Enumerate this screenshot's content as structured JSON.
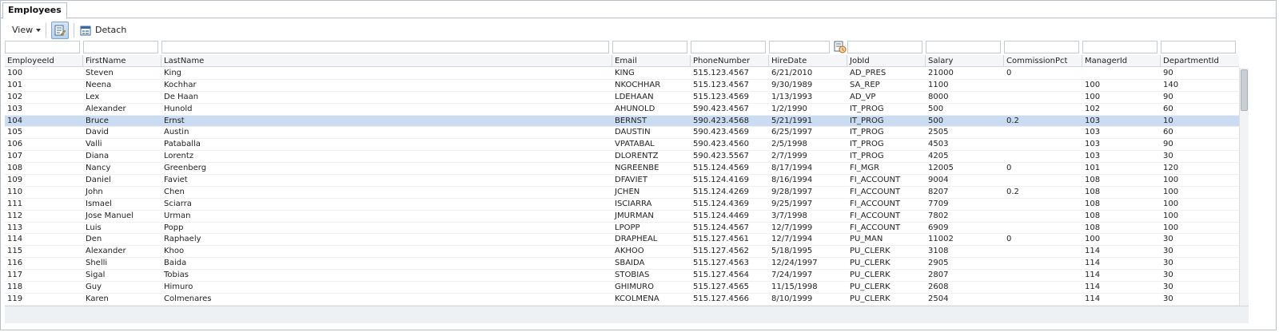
{
  "tab": {
    "label": "Employees"
  },
  "toolbar": {
    "view_label": "View",
    "detach_label": "Detach"
  },
  "columns": [
    {
      "key": "id",
      "label": "EmployeeId"
    },
    {
      "key": "first",
      "label": "FirstName"
    },
    {
      "key": "last",
      "label": "LastName"
    },
    {
      "key": "email",
      "label": "Email"
    },
    {
      "key": "phone",
      "label": "PhoneNumber"
    },
    {
      "key": "hire",
      "label": "HireDate"
    },
    {
      "key": "job",
      "label": "JobId"
    },
    {
      "key": "salary",
      "label": "Salary"
    },
    {
      "key": "comm",
      "label": "CommissionPct"
    },
    {
      "key": "mgr",
      "label": "ManagerId"
    },
    {
      "key": "dept",
      "label": "DepartmentId"
    }
  ],
  "rows": [
    {
      "id": "100",
      "first": "Steven",
      "last": "King",
      "email": "KING",
      "phone": "515.123.4567",
      "hire": "6/21/2010",
      "job": "AD_PRES",
      "salary": "21000",
      "comm": "0",
      "mgr": "",
      "dept": "90"
    },
    {
      "id": "101",
      "first": "Neena",
      "last": "Kochhar",
      "email": "NKOCHHAR",
      "phone": "515.123.4567",
      "hire": "9/30/1989",
      "job": "SA_REP",
      "salary": "1100",
      "comm": "",
      "mgr": "100",
      "dept": "140"
    },
    {
      "id": "102",
      "first": "Lex",
      "last": "De Haan",
      "email": "LDEHAAN",
      "phone": "515.123.4569",
      "hire": "1/13/1993",
      "job": "AD_VP",
      "salary": "8000",
      "comm": "",
      "mgr": "100",
      "dept": "90"
    },
    {
      "id": "103",
      "first": "Alexander",
      "last": "Hunold",
      "email": "AHUNOLD",
      "phone": "590.423.4567",
      "hire": "1/2/1990",
      "job": "IT_PROG",
      "salary": "500",
      "comm": "",
      "mgr": "102",
      "dept": "60"
    },
    {
      "id": "104",
      "first": "Bruce",
      "last": "Ernst",
      "email": "BERNST",
      "phone": "590.423.4568",
      "hire": "5/21/1991",
      "job": "IT_PROG",
      "salary": "500",
      "comm": "0.2",
      "mgr": "103",
      "dept": "10",
      "selected": true
    },
    {
      "id": "105",
      "first": "David",
      "last": "Austin",
      "email": "DAUSTIN",
      "phone": "590.423.4569",
      "hire": "6/25/1997",
      "job": "IT_PROG",
      "salary": "2505",
      "comm": "",
      "mgr": "103",
      "dept": "60"
    },
    {
      "id": "106",
      "first": "Valli",
      "last": "Pataballa",
      "email": "VPATABAL",
      "phone": "590.423.4560",
      "hire": "2/5/1998",
      "job": "IT_PROG",
      "salary": "4503",
      "comm": "",
      "mgr": "103",
      "dept": "90"
    },
    {
      "id": "107",
      "first": "Diana",
      "last": "Lorentz",
      "email": "DLORENTZ",
      "phone": "590.423.5567",
      "hire": "2/7/1999",
      "job": "IT_PROG",
      "salary": "4205",
      "comm": "",
      "mgr": "103",
      "dept": "30"
    },
    {
      "id": "108",
      "first": "Nancy",
      "last": "Greenberg",
      "email": "NGREENBE",
      "phone": "515.124.4569",
      "hire": "8/17/1994",
      "job": "FI_MGR",
      "salary": "12005",
      "comm": "0",
      "mgr": "101",
      "dept": "120"
    },
    {
      "id": "109",
      "first": "Daniel",
      "last": "Faviet",
      "email": "DFAVIET",
      "phone": "515.124.4169",
      "hire": "8/16/1994",
      "job": "FI_ACCOUNT",
      "salary": "9004",
      "comm": "",
      "mgr": "108",
      "dept": "100"
    },
    {
      "id": "110",
      "first": "John",
      "last": "Chen",
      "email": "JCHEN",
      "phone": "515.124.4269",
      "hire": "9/28/1997",
      "job": "FI_ACCOUNT",
      "salary": "8207",
      "comm": "0.2",
      "mgr": "108",
      "dept": "100"
    },
    {
      "id": "111",
      "first": "Ismael",
      "last": "Sciarra",
      "email": "ISCIARRA",
      "phone": "515.124.4369",
      "hire": "9/25/1997",
      "job": "FI_ACCOUNT",
      "salary": "7709",
      "comm": "",
      "mgr": "108",
      "dept": "100"
    },
    {
      "id": "112",
      "first": "Jose Manuel",
      "last": "Urman",
      "email": "JMURMAN",
      "phone": "515.124.4469",
      "hire": "3/7/1998",
      "job": "FI_ACCOUNT",
      "salary": "7802",
      "comm": "",
      "mgr": "108",
      "dept": "100"
    },
    {
      "id": "113",
      "first": "Luis",
      "last": "Popp",
      "email": "LPOPP",
      "phone": "515.124.4567",
      "hire": "12/7/1999",
      "job": "FI_ACCOUNT",
      "salary": "6909",
      "comm": "",
      "mgr": "108",
      "dept": "100"
    },
    {
      "id": "114",
      "first": "Den",
      "last": "Raphaely",
      "email": "DRAPHEAL",
      "phone": "515.127.4561",
      "hire": "12/7/1994",
      "job": "PU_MAN",
      "salary": "11002",
      "comm": "0",
      "mgr": "100",
      "dept": "30"
    },
    {
      "id": "115",
      "first": "Alexander",
      "last": "Khoo",
      "email": "AKHOO",
      "phone": "515.127.4562",
      "hire": "5/18/1995",
      "job": "PU_CLERK",
      "salary": "3108",
      "comm": "",
      "mgr": "114",
      "dept": "30"
    },
    {
      "id": "116",
      "first": "Shelli",
      "last": "Baida",
      "email": "SBAIDA",
      "phone": "515.127.4563",
      "hire": "12/24/1997",
      "job": "PU_CLERK",
      "salary": "2905",
      "comm": "",
      "mgr": "114",
      "dept": "30"
    },
    {
      "id": "117",
      "first": "Sigal",
      "last": "Tobias",
      "email": "STOBIAS",
      "phone": "515.127.4564",
      "hire": "7/24/1997",
      "job": "PU_CLERK",
      "salary": "2807",
      "comm": "",
      "mgr": "114",
      "dept": "30"
    },
    {
      "id": "118",
      "first": "Guy",
      "last": "Himuro",
      "email": "GHIMURO",
      "phone": "515.127.4565",
      "hire": "11/15/1998",
      "job": "PU_CLERK",
      "salary": "2608",
      "comm": "",
      "mgr": "114",
      "dept": "30"
    },
    {
      "id": "119",
      "first": "Karen",
      "last": "Colmenares",
      "email": "KCOLMENA",
      "phone": "515.127.4566",
      "hire": "8/10/1999",
      "job": "PU_CLERK",
      "salary": "2504",
      "comm": "",
      "mgr": "114",
      "dept": "30"
    }
  ],
  "icons": {
    "toggle": "edit-list-icon",
    "detach": "detach-window-icon",
    "qbe": "query-by-example-icon"
  }
}
